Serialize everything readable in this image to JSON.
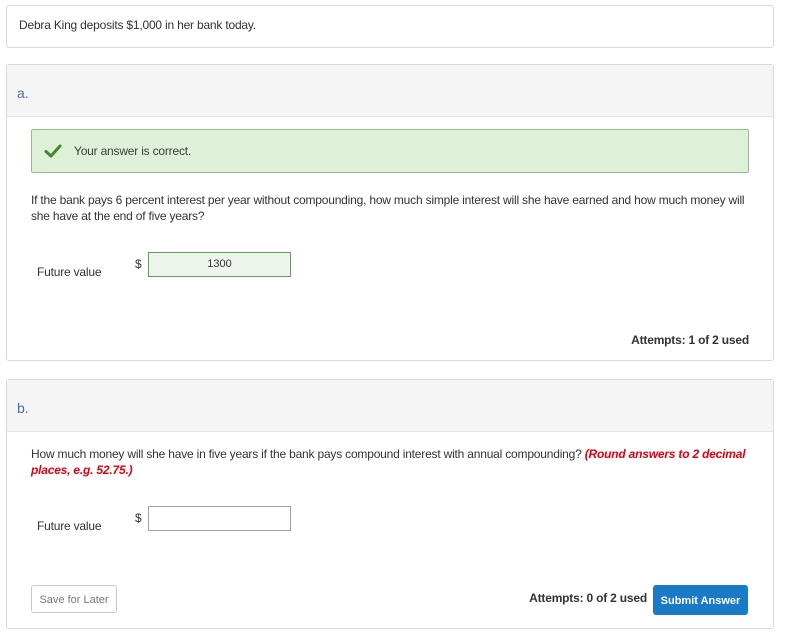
{
  "intro": {
    "text": "Debra King deposits $1,000 in her bank today."
  },
  "part_a": {
    "letter": "a.",
    "alert": {
      "text": "Your answer is correct.",
      "icon": "check-icon",
      "color": "#3a8a2e"
    },
    "question": "If the bank pays 6 percent interest per year without compounding, how much simple interest will she have earned and how much money will she have at the end of five years?",
    "field_label": "Future value",
    "currency": "$",
    "answer_value": "1300",
    "attempts": "Attempts: 1 of 2 used"
  },
  "part_b": {
    "letter": "b.",
    "question": "How much money will she have in five years if the bank pays compound interest with annual compounding?",
    "hint": "(Round answers to 2 decimal places, e.g. 52.75.)",
    "field_label": "Future value",
    "currency": "$",
    "answer_value": "",
    "attempts": "Attempts: 0 of 2 used",
    "save_label": "Save for Later",
    "submit_label": "Submit Answer"
  },
  "colors": {
    "accent": "#1a7ac7",
    "success_bg": "#dff0d8",
    "hint": "#e0000f"
  }
}
